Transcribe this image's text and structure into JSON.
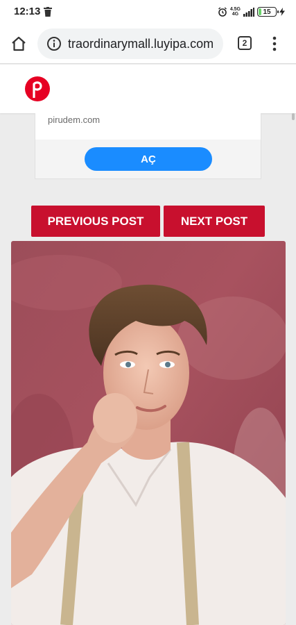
{
  "status_bar": {
    "time": "12:13",
    "network_top": "4.5G",
    "network_bottom": "4G",
    "battery": "15",
    "battery_level": 0.15
  },
  "browser": {
    "url": "traordinarymall.luyipa.com",
    "tab_count": "2"
  },
  "site": {
    "logo_letter": "p",
    "brand_color": "#e60023"
  },
  "ad": {
    "domain": "pirudem.com",
    "button_label": "AÇ",
    "button_color": "#1a8cff"
  },
  "navigation": {
    "previous_label": "PREVIOUS POST",
    "next_label": "NEXT POST",
    "button_color": "#c8102e"
  },
  "photo": {
    "icon": "portrait-photo"
  }
}
